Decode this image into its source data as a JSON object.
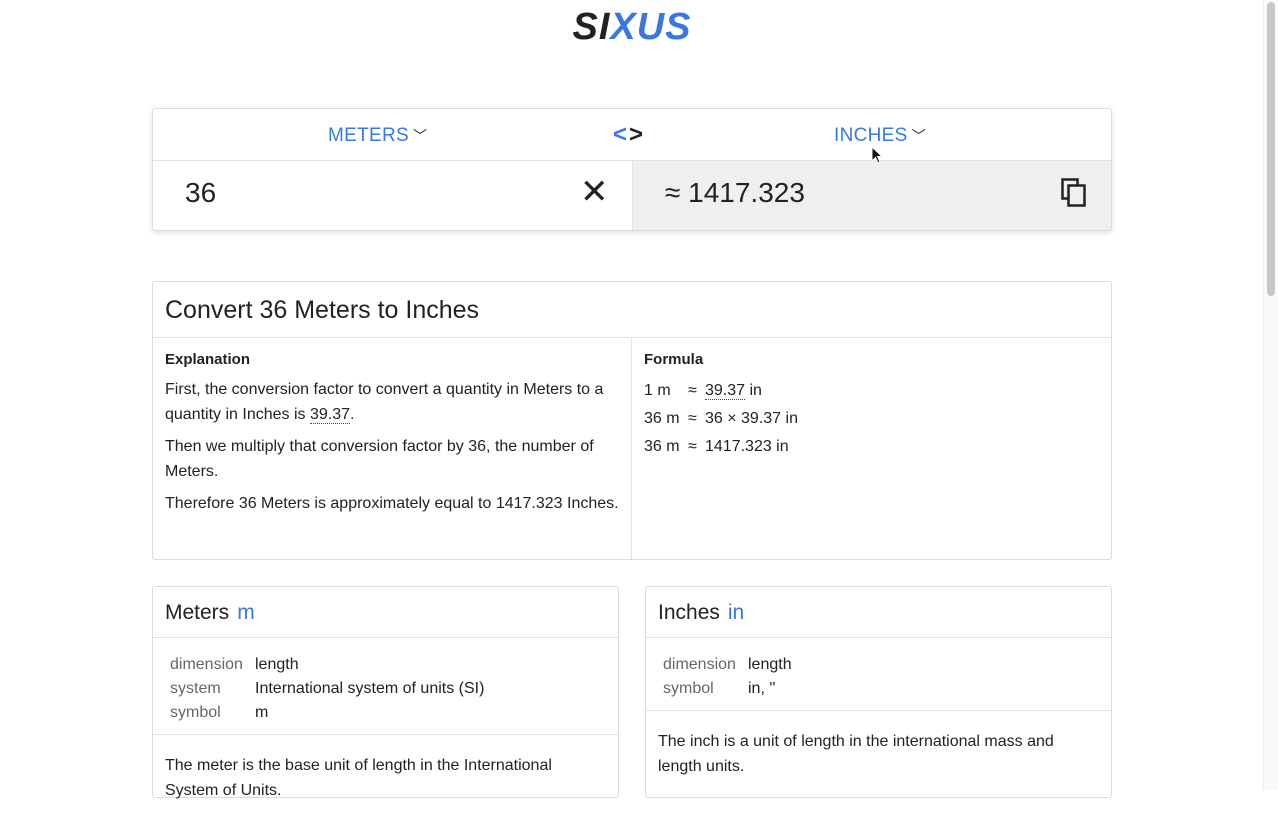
{
  "logo": {
    "part1": "SI",
    "part2": "X",
    "part3": "US"
  },
  "converter": {
    "from_unit": "METERS",
    "to_unit": "INCHES",
    "input_value": "36",
    "output_value": "≈ 1417.323"
  },
  "explanation": {
    "title": "Convert 36 Meters to Inches",
    "explanation_heading": "Explanation",
    "para1_before": "First, the conversion factor to convert a quantity in Meters to a quantity in Inches is ",
    "para1_factor": "39.37",
    "para1_after": ".",
    "para2": "Then we multiply that conversion factor by 36, the number of Meters.",
    "para3": "Therefore 36 Meters is approximately equal to 1417.323 Inches.",
    "formula_heading": "Formula",
    "formula_rows": [
      {
        "lhs": "1 m",
        "approx": "≈",
        "rhs_factor": "39.37",
        "rhs_unit": " in"
      },
      {
        "lhs": "36 m",
        "approx": "≈",
        "rhs": "36 × 39.37 in"
      },
      {
        "lhs": "36 m",
        "approx": "≈",
        "rhs": "1417.323 in"
      }
    ]
  },
  "meters_card": {
    "name": "Meters",
    "symbol": "m",
    "props": [
      {
        "key": "dimension",
        "value": "length"
      },
      {
        "key": "system",
        "value": "International system of units (SI)"
      },
      {
        "key": "symbol",
        "value": "m"
      }
    ],
    "description": "The meter is the base unit of length in the International System of Units."
  },
  "inches_card": {
    "name": "Inches",
    "symbol": "in",
    "props": [
      {
        "key": "dimension",
        "value": "length"
      },
      {
        "key": "symbol",
        "value": "in, ''"
      }
    ],
    "description": "The inch is a unit of length in the international mass and length units."
  }
}
